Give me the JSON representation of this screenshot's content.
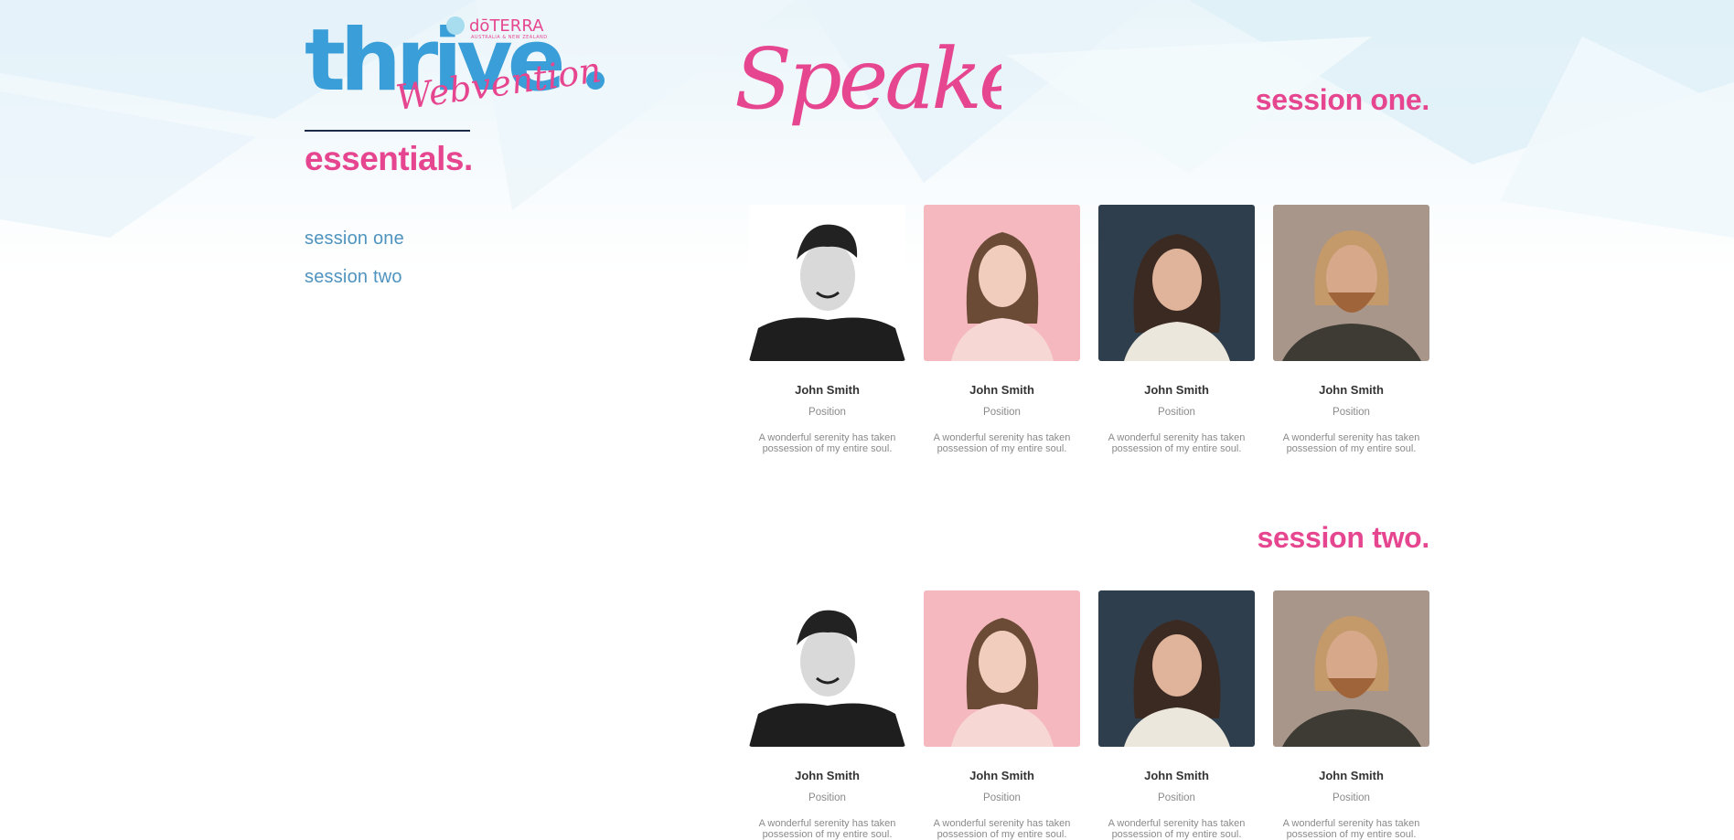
{
  "brand": {
    "logo_word": "thrive",
    "logo_subtitle": "Webvention",
    "logo_sponsor": "dōTERRA",
    "logo_sponsor_region": "AUSTRALIA & NEW ZEALAND",
    "accent_pink": "#e6468f",
    "accent_blue": "#4f93bf",
    "logo_blue": "#3a9ed8",
    "logo_light_blue": "#a8dcef"
  },
  "sidebar": {
    "heading": "essentials.",
    "links": [
      {
        "label": "session one"
      },
      {
        "label": "session two"
      }
    ]
  },
  "main": {
    "title": "Speakers",
    "sessions": [
      {
        "heading": "session one.",
        "speakers": [
          {
            "name": "John Smith",
            "position": "Position",
            "bio": "A wonderful serenity has taken possession of my entire soul.",
            "photo": "man-bw-portrait"
          },
          {
            "name": "John Smith",
            "position": "Position",
            "bio": "A wonderful serenity has taken possession of my entire soul.",
            "photo": "woman-pink-portrait"
          },
          {
            "name": "John Smith",
            "position": "Position",
            "bio": "A wonderful serenity has taken possession of my entire soul.",
            "photo": "woman-dark-portrait"
          },
          {
            "name": "John Smith",
            "position": "Position",
            "bio": "A wonderful serenity has taken possession of my entire soul.",
            "photo": "man-beard-portrait"
          }
        ]
      },
      {
        "heading": "session two.",
        "speakers": [
          {
            "name": "John Smith",
            "position": "Position",
            "bio": "A wonderful serenity has taken possession of my entire soul.",
            "photo": "man-bw-portrait"
          },
          {
            "name": "John Smith",
            "position": "Position",
            "bio": "A wonderful serenity has taken possession of my entire soul.",
            "photo": "woman-pink-portrait"
          },
          {
            "name": "John Smith",
            "position": "Position",
            "bio": "A wonderful serenity has taken possession of my entire soul.",
            "photo": "woman-dark-portrait"
          },
          {
            "name": "John Smith",
            "position": "Position",
            "bio": "A wonderful serenity has taken possession of my entire soul.",
            "photo": "man-beard-portrait"
          }
        ]
      }
    ]
  }
}
